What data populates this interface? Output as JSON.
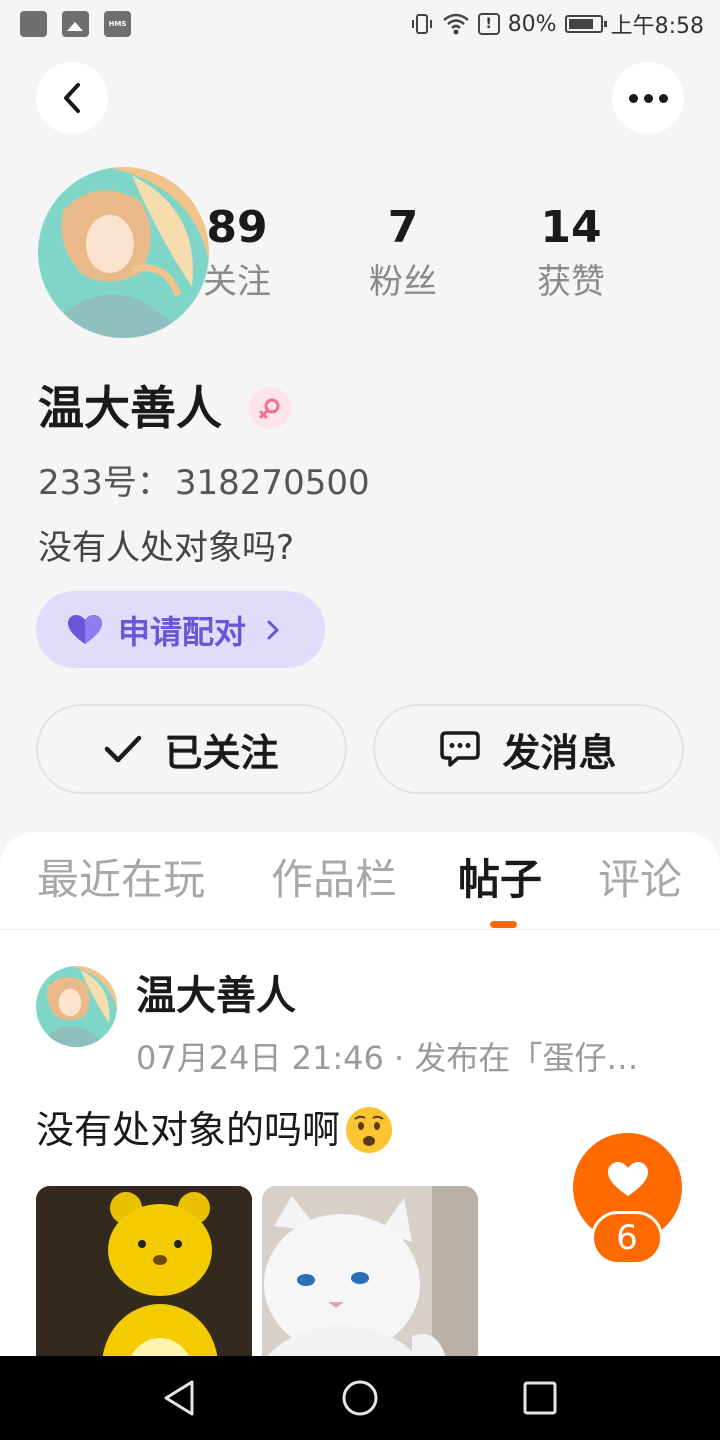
{
  "status_bar": {
    "battery": "80%",
    "time": "上午8:58",
    "hms_label": "HMS"
  },
  "profile": {
    "username": "温大善人",
    "id_label": "233号：",
    "id_value": "318270500",
    "bio": "没有人处对象吗?",
    "gender": "female",
    "stats": [
      {
        "value": "89",
        "label": "关注"
      },
      {
        "value": "7",
        "label": "粉丝"
      },
      {
        "value": "14",
        "label": "获赞"
      }
    ]
  },
  "pair_button": {
    "label": "申请配对"
  },
  "actions": {
    "follow_label": "已关注",
    "message_label": "发消息"
  },
  "tabs": [
    {
      "label": "最近在玩",
      "active": false
    },
    {
      "label": "作品栏",
      "active": false
    },
    {
      "label": "帖子",
      "active": true
    },
    {
      "label": "评论",
      "active": false
    }
  ],
  "post": {
    "author": "温大善人",
    "meta": "07月24日 21:46 · 发布在「蛋仔…",
    "text": "没有处对象的吗啊",
    "like_count": "6"
  },
  "colors": {
    "accent": "#ff6a00",
    "pair_bg": "#e1dcfa",
    "pair_text": "#6a56d8",
    "gender_badge": "#f1708f"
  },
  "icons": {
    "back": "chevron-left-icon",
    "more": "more-dots-icon",
    "pair": "heart-icon",
    "follow": "check-icon",
    "message": "chat-bubble-icon",
    "like": "heart-icon"
  }
}
